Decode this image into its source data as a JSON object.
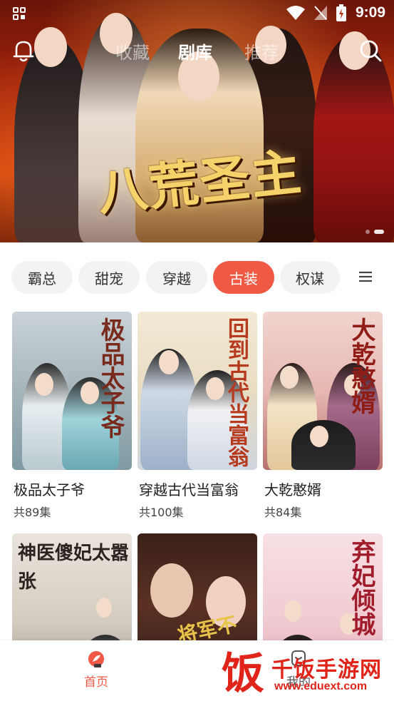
{
  "status_bar": {
    "time": "9:09"
  },
  "top_nav": {
    "tabs": [
      {
        "label": "收藏",
        "active": false
      },
      {
        "label": "剧库",
        "active": true
      },
      {
        "label": "推荐",
        "active": false
      }
    ],
    "icons": [
      "bell-icon",
      "search-icon"
    ]
  },
  "banner": {
    "title": "八荒圣主"
  },
  "categories": {
    "items": [
      {
        "label": "霸总",
        "active": false
      },
      {
        "label": "甜宠",
        "active": false
      },
      {
        "label": "穿越",
        "active": false
      },
      {
        "label": "古装",
        "active": true
      },
      {
        "label": "权谋",
        "active": false
      }
    ],
    "menu_icon": "menu-icon"
  },
  "dramas": [
    {
      "poster_text": "极品太子爷",
      "title": "极品太子爷",
      "episodes": "共89集"
    },
    {
      "poster_text": "回到古代当富翁",
      "title": "穿越古代当富翁",
      "episodes": "共100集"
    },
    {
      "poster_text": "大乾憨婿",
      "title": "大乾憨婿",
      "episodes": "共84集"
    },
    {
      "poster_text": "神医傻妃太嚣张",
      "title": "",
      "episodes": ""
    },
    {
      "poster_text": "将军不",
      "title": "",
      "episodes": ""
    },
    {
      "poster_text": "弃妃倾城",
      "title": "",
      "episodes": ""
    }
  ],
  "bottom_nav": {
    "home_label": "首页",
    "me_label": "我的"
  },
  "watermark": {
    "glyph": "饭",
    "name": "千饭手游网",
    "url": "www.eduext.com"
  },
  "colors": {
    "accent": "#f05a44",
    "watermark": "#e0241a"
  }
}
